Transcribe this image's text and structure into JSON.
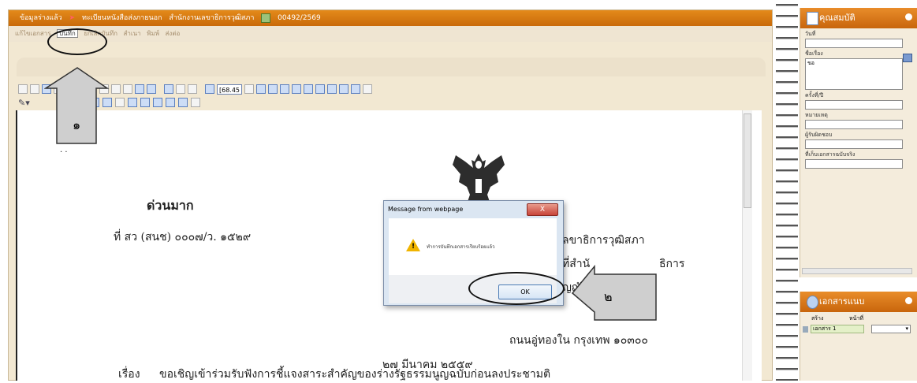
{
  "window": {
    "title_prefix": "ข้อมูลร่างแล้ว",
    "title_type": "ทะเบียนหนังสือส่งภายนอก",
    "title_org": "สำนักงานเลขาธิการวุฒิสภา",
    "title_number": "00492/2569"
  },
  "menu": {
    "items": [
      "แก้ไขเอกสาร",
      "บันทึก",
      "ยกเลิกบันทึก",
      "สำเนา",
      "พิมพ์",
      "ส่งต่อ"
    ],
    "active_index": 1
  },
  "toolbar": {
    "zoom_value": "[68.45"
  },
  "document": {
    "urgency": "ด่วนมาก",
    "ref_no": "ที่ สว (สนช) ๐๐๐๗/ว. ๑๕๒๙",
    "addr_line1": "ลขาธิการวุฒิสภา",
    "addr_line2": "ที่สำนั",
    "addr_line2b": "ธิการ",
    "addr_line3": "ญญัติแ",
    "addr_line4": "ถนนอู่ทองใน  กรุงเทพ ๑๐๓๐๐",
    "date": "๒๗ มีนาคม ๒๕๕๙",
    "subject_label": "เรื่อง",
    "subject": "ขอเชิญเข้าร่วมรับฟังการชี้แจงสาระสำคัญของร่างรัฐธรรมนูญฉบับก่อนลงประชามติ"
  },
  "dialog": {
    "title": "Message from webpage",
    "close_label": "X",
    "message": "ทำการบันทึกเอกสารเรียบร้อยแล้ว",
    "ok_label": "OK"
  },
  "annotations": {
    "step1": "๑",
    "step2": "๒"
  },
  "properties_panel": {
    "title": "คุณสมบัติ",
    "fields": [
      {
        "label": "วันที่",
        "value": ""
      },
      {
        "label": "ชื่อเรื่อง",
        "value": "ขอ"
      },
      {
        "label": "ครั้งที่/ปี",
        "value": ""
      },
      {
        "label": "หมายเหตุ",
        "value": ""
      },
      {
        "label": "ผู้รับผิดชอบ",
        "value": ""
      },
      {
        "label": "ที่เก็บเอกสารฉบับจริง",
        "value": ""
      }
    ]
  },
  "attachments_panel": {
    "title": "เอกสารแนบ",
    "col_create": "สร้าง",
    "col_page": "หน้าที่",
    "item_name": "เอกสาร 1"
  }
}
